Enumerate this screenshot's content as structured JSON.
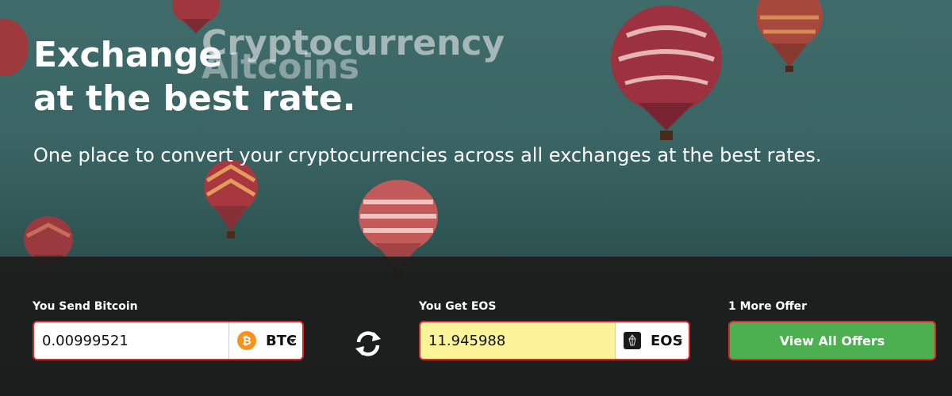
{
  "hero": {
    "title_line1": "Exchange",
    "title_line2": "at the best rate.",
    "rotating_word_1": "Cryptocurrency",
    "rotating_word_2": "Altcoins",
    "subtitle": "One place to convert your cryptocurrencies across all exchanges at the best rates."
  },
  "send": {
    "label": "You Send Bitcoin",
    "amount": "0.00999521",
    "coin_code": "BTC",
    "coin_icon": "bitcoin-icon",
    "coin_color": "#f7931a"
  },
  "get": {
    "label": "You Get EOS",
    "amount": "11.945988",
    "coin_code": "EOS",
    "coin_icon": "eos-icon",
    "highlight_color": "#fdf49a"
  },
  "offers": {
    "label": "1 More Offer",
    "button_label": "View All Offers",
    "button_color": "#4caf50"
  },
  "colors": {
    "accent_border": "#e0262d"
  }
}
